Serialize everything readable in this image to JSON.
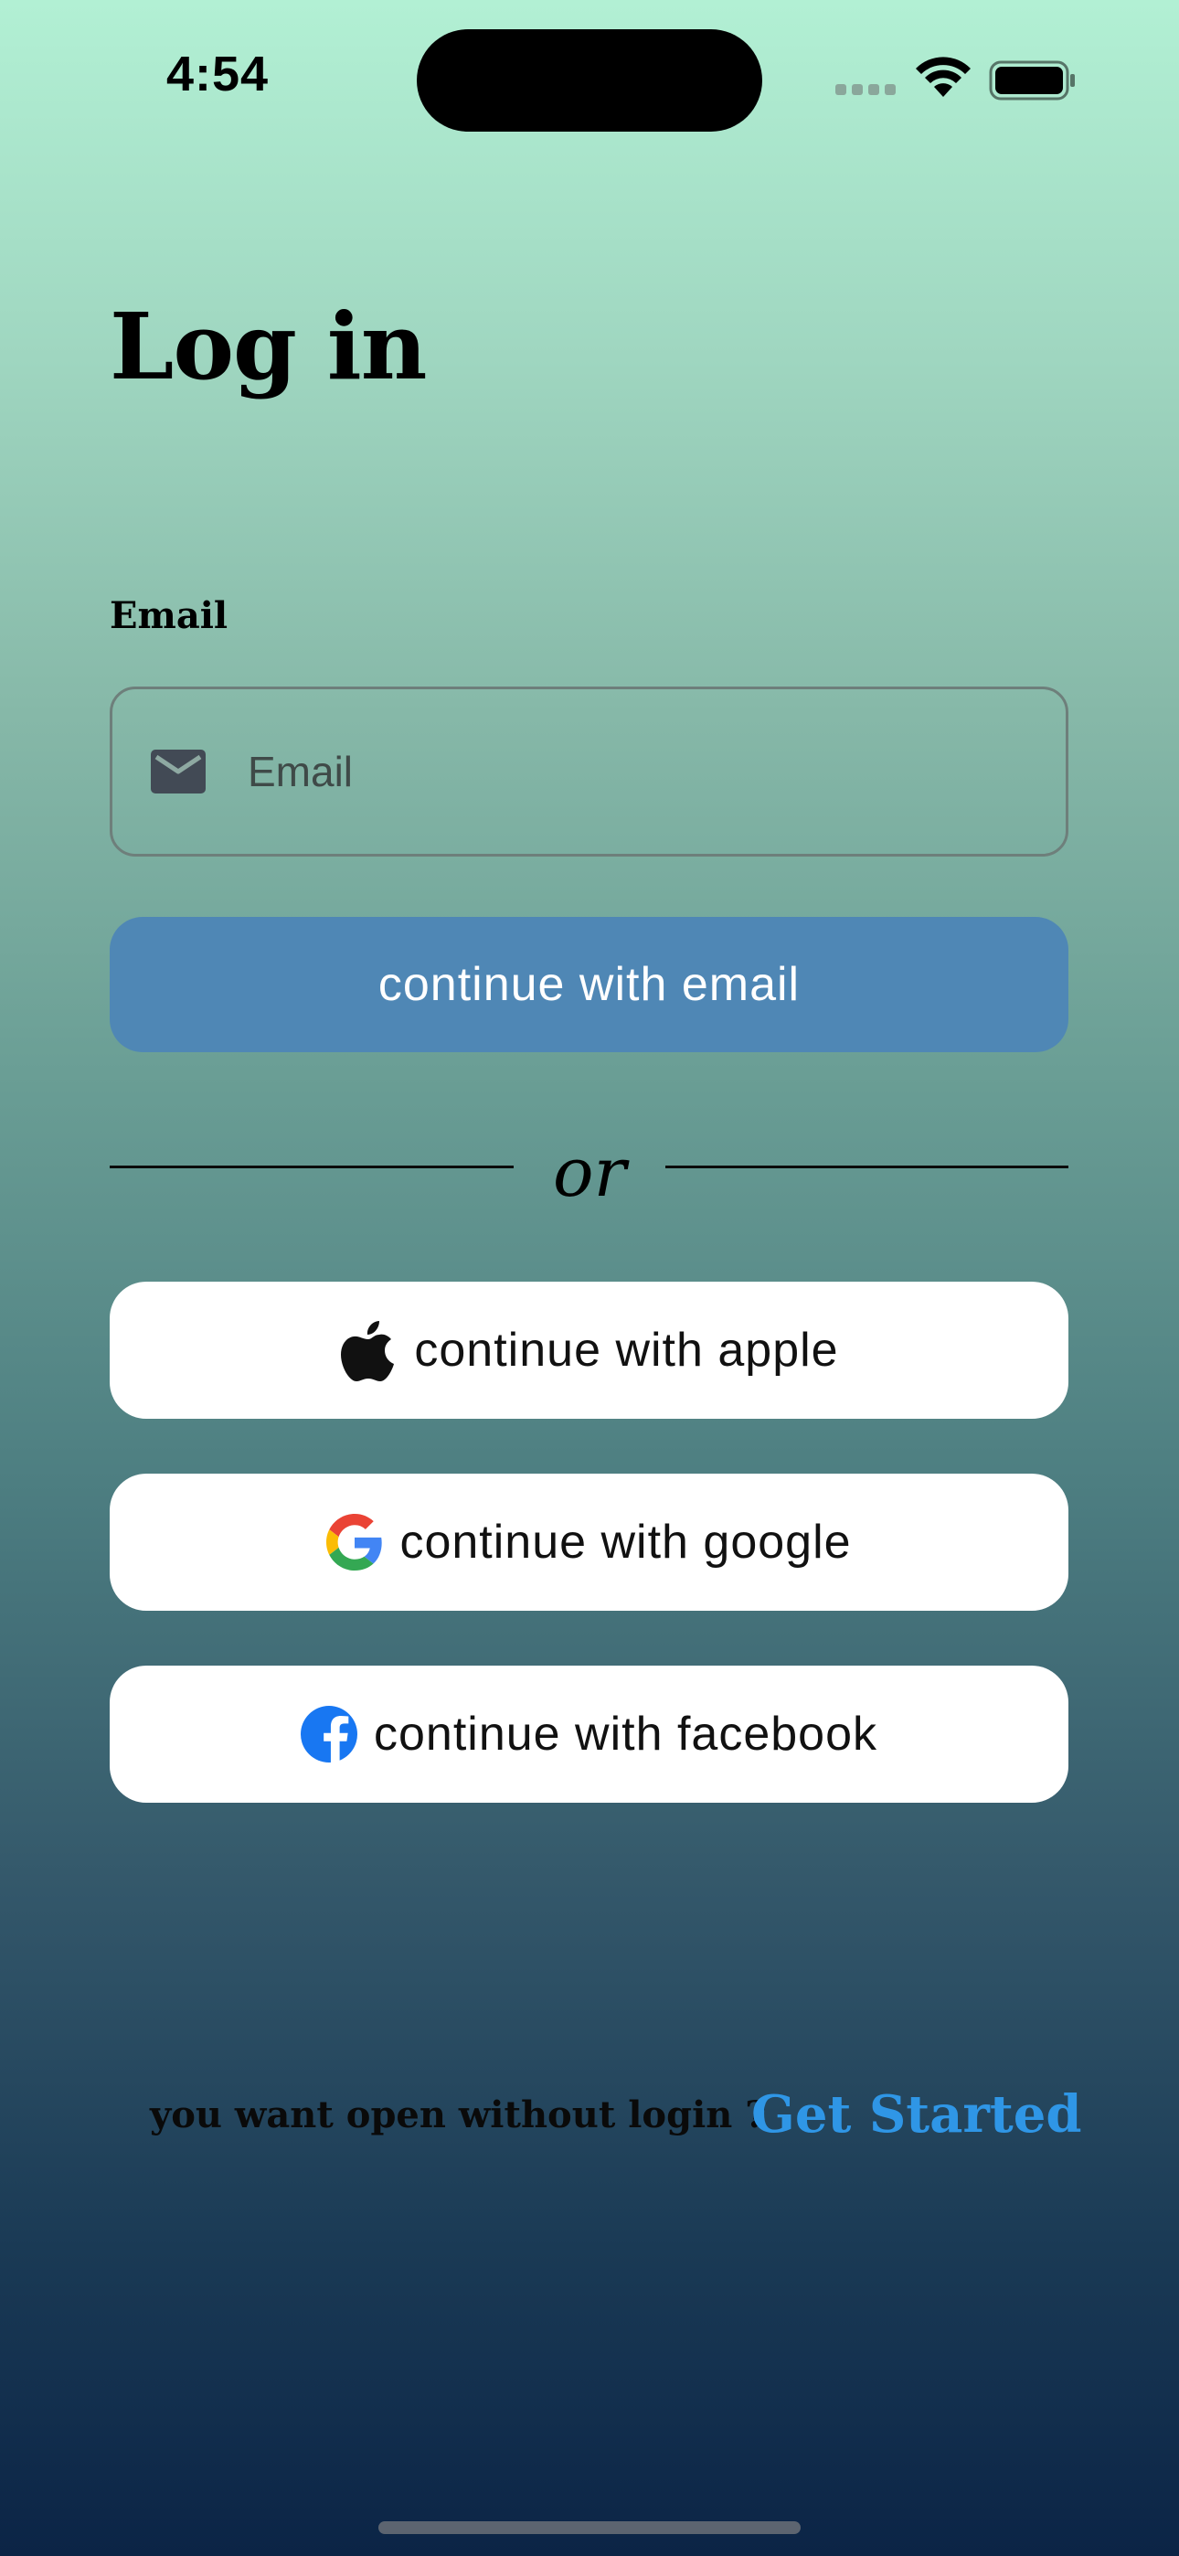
{
  "status_bar": {
    "time": "4:54"
  },
  "page": {
    "title": "Log in"
  },
  "email": {
    "label": "Email",
    "placeholder": "Email",
    "value": ""
  },
  "buttons": {
    "continue_email": "continue with email",
    "divider": "or",
    "apple": "continue with apple",
    "google": "continue with google",
    "facebook": "continue with facebook"
  },
  "footer": {
    "prompt": "you want open without login ?",
    "get_started": "Get Started"
  },
  "colors": {
    "email_button": "#4f87b5",
    "get_started_link": "#2f96e6",
    "facebook_blue": "#1877f2"
  },
  "icons": [
    "mail-icon",
    "apple-icon",
    "google-icon",
    "facebook-icon",
    "wifi-icon",
    "battery-icon"
  ]
}
